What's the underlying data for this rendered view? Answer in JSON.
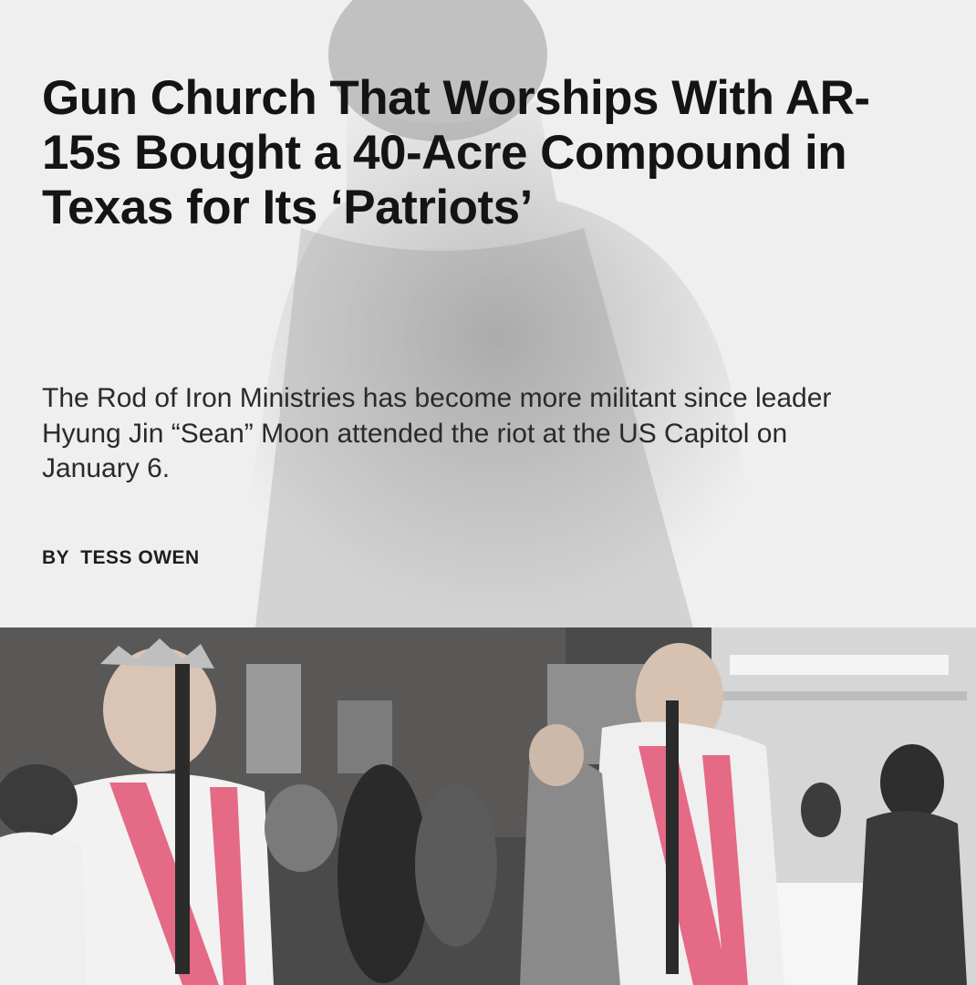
{
  "article": {
    "headline": "Gun Church That Worships With AR-15s Bought a 40-Acre Compound in Texas for Its ‘Patriots’",
    "dek": "The Rod of Iron Ministries has become more militant since leader Hyung Jin “Sean” Moon attended the riot at the US Capitol on January 6.",
    "byline_prefix": "BY",
    "author": "TESS OWEN"
  },
  "photo": {
    "icon": "photo-image",
    "palette": {
      "robe": "#f2f2f2",
      "sash": "#e46a86",
      "shadow": "#3a3a3a"
    }
  }
}
